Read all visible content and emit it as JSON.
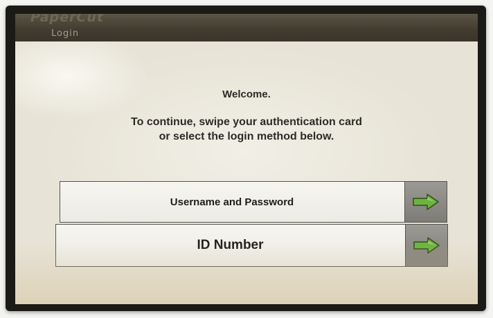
{
  "header": {
    "brand": "PaperCut",
    "title": "Login"
  },
  "main": {
    "welcome": "Welcome.",
    "instructions_line1": "To continue, swipe your authentication card",
    "instructions_line2": "or select the login method below."
  },
  "login_methods": [
    {
      "label": "Username and Password",
      "icon": "arrow-right-icon"
    },
    {
      "label": "ID Number",
      "icon": "arrow-right-icon"
    }
  ],
  "colors": {
    "header_bar": "#433c31",
    "screen_background": "#e8e4d8",
    "arrow_button": "#8a8882",
    "arrow_green": "#6db33f"
  }
}
